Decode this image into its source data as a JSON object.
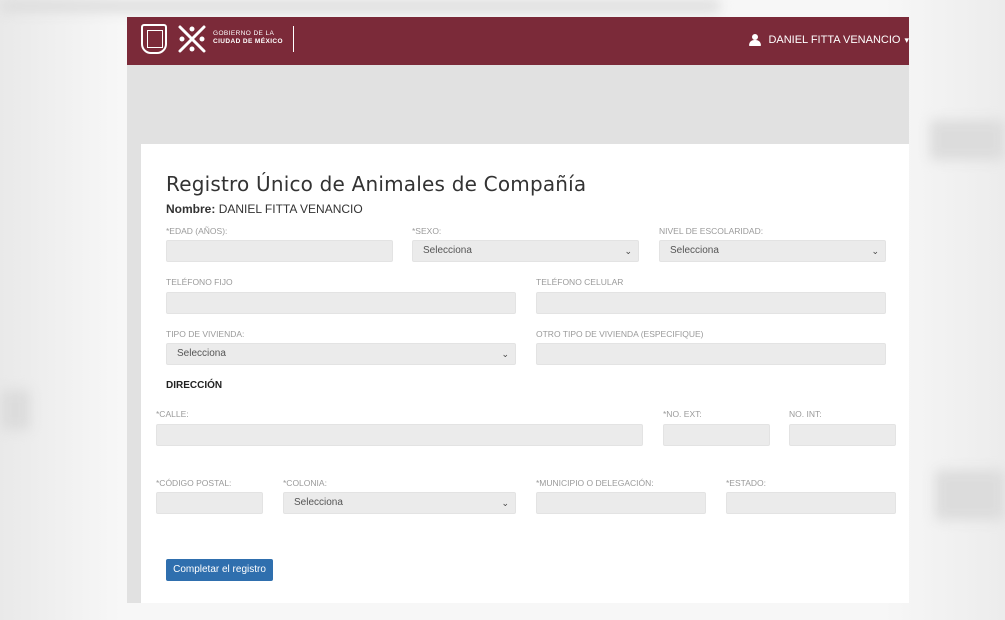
{
  "header": {
    "gov_line1": "GOBIERNO DE LA",
    "gov_line2": "CIUDAD DE MÉXICO",
    "user_name": "DANIEL FITTA VENANCIO",
    "brand_color": "#7b2a39"
  },
  "form": {
    "title": "Registro Único de Animales de Compañía",
    "name_label": "Nombre:",
    "name_value": "DANIEL FITTA VENANCIO",
    "fields": {
      "edad": "*EDAD (AÑOS):",
      "sexo": "*SEXO:",
      "escolaridad": "NIVEL DE ESCOLARIDAD:",
      "telefono_fijo": "TELÉFONO FIJO",
      "telefono_celular": "TELÉFONO CELULAR",
      "tipo_vivienda": "TIPO DE VIVIENDA:",
      "otro_vivienda": "OTRO TIPO DE VIVIENDA (ESPECIFIQUE)",
      "calle": "*CALLE:",
      "no_ext": "*NO. EXT:",
      "no_int": "NO. INT:",
      "cp": "*CÓDIGO POSTAL:",
      "colonia": "*COLONIA:",
      "municipio": "*MUNICIPIO O DELEGACIÓN:",
      "estado": "*ESTADO:"
    },
    "select_placeholder": "Selecciona",
    "section_direccion": "DIRECCIÓN",
    "submit_label": "Completar el registro",
    "button_color": "#2f6fae"
  }
}
